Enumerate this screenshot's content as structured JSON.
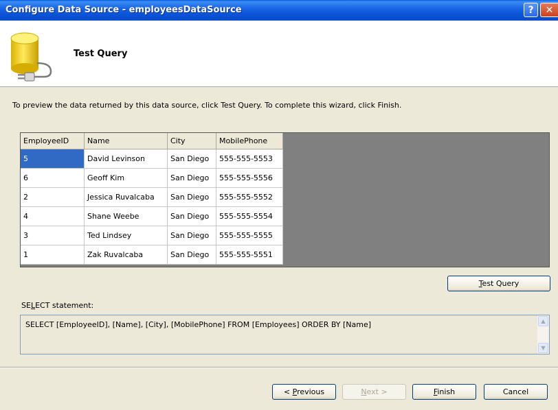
{
  "window": {
    "title": "Configure Data Source - employeesDataSource",
    "help_label": "?",
    "close_label": "✕"
  },
  "header": {
    "title": "Test Query",
    "icon": "database-plug-icon"
  },
  "instructions": "To preview the data returned by this data source, click Test Query. To complete this wizard, click Finish.",
  "grid": {
    "columns": [
      "EmployeeID",
      "Name",
      "City",
      "MobilePhone"
    ],
    "rows": [
      [
        "5",
        "David Levinson",
        "San Diego",
        "555-555-5553"
      ],
      [
        "6",
        "Geoff Kim",
        "San Diego",
        "555-555-5556"
      ],
      [
        "2",
        "Jessica Ruvalcaba",
        "San Diego",
        "555-555-5552"
      ],
      [
        "4",
        "Shane Weebe",
        "San Diego",
        "555-555-5554"
      ],
      [
        "3",
        "Ted Lindsey",
        "San Diego",
        "555-555-5555"
      ],
      [
        "1",
        "Zak Ruvalcaba",
        "San Diego",
        "555-555-5551"
      ]
    ]
  },
  "buttons": {
    "test_query": {
      "pre": "",
      "key": "T",
      "post": "est Query"
    },
    "previous": {
      "pre": "< ",
      "key": "P",
      "post": "revious"
    },
    "next": {
      "pre": "",
      "key": "N",
      "post": "ext >"
    },
    "finish": {
      "pre": "",
      "key": "F",
      "post": "inish"
    },
    "cancel": "Cancel"
  },
  "sql": {
    "label_pre": "SE",
    "label_key": "L",
    "label_post": "ECT statement:",
    "statement": "SELECT [EmployeeID], [Name], [City], [MobilePhone] FROM [Employees] ORDER BY [Name]"
  },
  "colors": {
    "titlebar": "#0b53d8",
    "selection": "#316ac5",
    "dialog_bg": "#ece9d8",
    "grid_bg": "#808080"
  }
}
